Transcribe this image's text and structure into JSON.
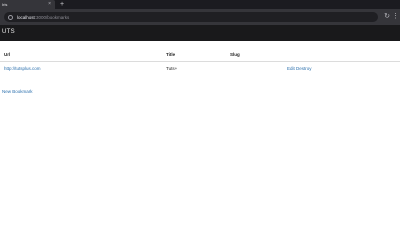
{
  "browser": {
    "tab_title": "Iris",
    "tab_close": "×",
    "new_tab": "+",
    "url_host": "localhost",
    "url_path": ":3000/bookmarks",
    "reload": "↻",
    "menu": "⋮"
  },
  "app": {
    "brand": "UTS"
  },
  "bookmarks_table": {
    "columns": [
      "Url",
      "Title",
      "Slug"
    ],
    "rows": [
      {
        "url": "http://tutsplus.com",
        "title": "Tuts+",
        "slug": "",
        "edit_label": "Edit",
        "destroy_label": "Destroy"
      }
    ]
  },
  "new_bookmark_label": "New Bookmark",
  "colors": {
    "link": "#2a6fad",
    "header_bg": "#19191b"
  }
}
